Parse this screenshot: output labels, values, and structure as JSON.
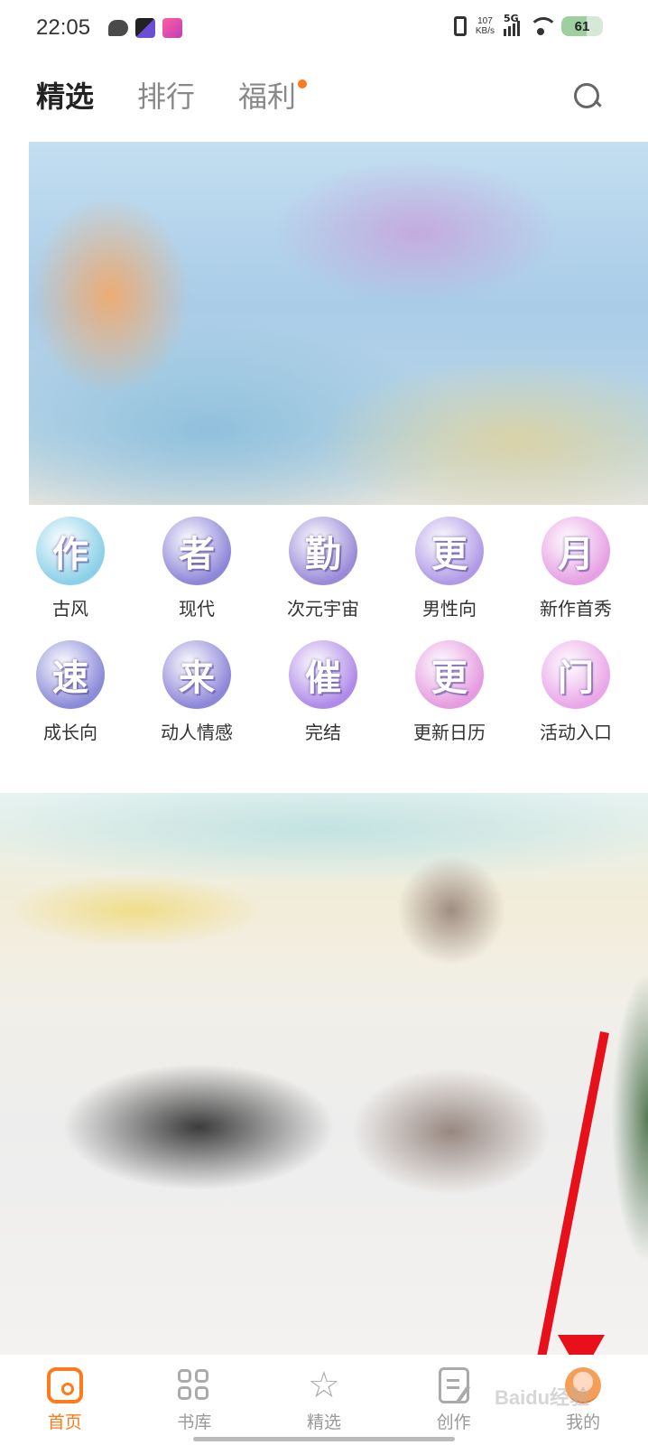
{
  "status_bar": {
    "time": "22:05",
    "net_speed_value": "107",
    "net_speed_unit": "KB/s",
    "network": "5G",
    "battery": "61"
  },
  "top_tabs": [
    {
      "label": "精选",
      "active": true
    },
    {
      "label": "排行",
      "active": false
    },
    {
      "label": "福利",
      "active": false,
      "badge_dot": true
    }
  ],
  "categories": [
    {
      "label": "古风",
      "glyph": "作",
      "color": "#8ad0e8"
    },
    {
      "label": "现代",
      "glyph": "者",
      "color": "#8e86d8"
    },
    {
      "label": "次元宇宙",
      "glyph": "勤",
      "color": "#9a8ad8"
    },
    {
      "label": "男性向",
      "glyph": "更",
      "color": "#b09ae6"
    },
    {
      "label": "新作首秀",
      "glyph": "月",
      "color": "#e6a0e4"
    },
    {
      "label": "成长向",
      "glyph": "速",
      "color": "#8a8ad8"
    },
    {
      "label": "动人情感",
      "glyph": "来",
      "color": "#8e86d8"
    },
    {
      "label": "完结",
      "glyph": "催",
      "color": "#b08ae8"
    },
    {
      "label": "更新日历",
      "glyph": "更",
      "color": "#e69ae0"
    },
    {
      "label": "活动入口",
      "glyph": "门",
      "color": "#eaa6e8"
    }
  ],
  "bottom_nav": [
    {
      "label": "首页",
      "icon": "home-icon",
      "active": true
    },
    {
      "label": "书库",
      "icon": "grid-icon",
      "active": false
    },
    {
      "label": "精选",
      "icon": "star-icon",
      "active": false
    },
    {
      "label": "创作",
      "icon": "edit-icon",
      "active": false
    },
    {
      "label": "我的",
      "icon": "avatar-icon",
      "active": false
    }
  ],
  "watermark": "Baidu经验",
  "colors": {
    "accent": "#ff7a1a",
    "annotation_arrow": "#e8101a"
  }
}
